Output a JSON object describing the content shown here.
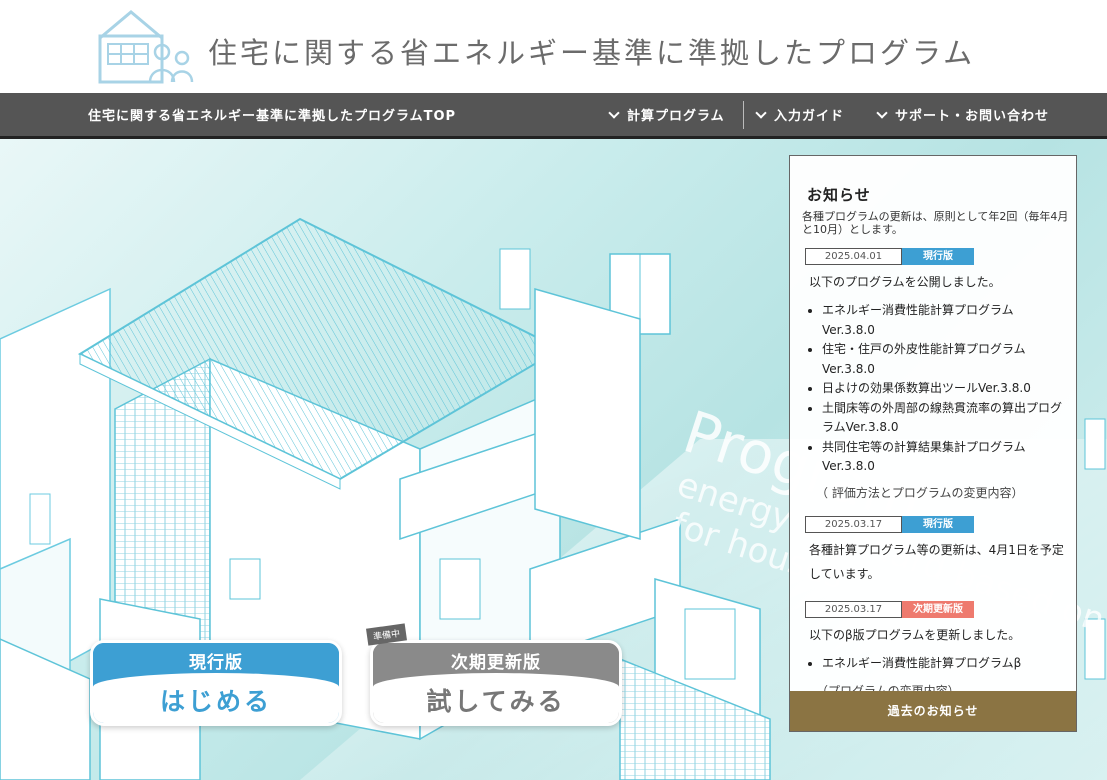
{
  "header": {
    "title": "住宅に関する省エネルギー基準に準拠したプログラム"
  },
  "nav": {
    "top": "住宅に関する省エネルギー基準に準拠したプログラムTOP",
    "items": [
      {
        "label": "計算プログラム"
      },
      {
        "label": "入力ガイド"
      },
      {
        "label": "サポート・お問い合わせ"
      }
    ]
  },
  "hero": {
    "bg_text_1": "Program",
    "bg_text_2": "energy standard based on",
    "bg_text_3": "for houses"
  },
  "buttons": {
    "current": {
      "top": "現行版",
      "bottom": "はじめる"
    },
    "next": {
      "top": "次期更新版",
      "bottom": "試してみる"
    },
    "prep_badge": "準備中"
  },
  "news": {
    "title": "お知らせ",
    "policy": "各種プログラムの更新は、原則として年2回（毎年4月と10月）とします。",
    "entries": [
      {
        "date": "2025.04.01",
        "badge": "現行版",
        "text": "以下のプログラムを公開しました。",
        "items": [
          "エネルギー消費性能計算プログラム Ver.3.8.0",
          "住宅・住戸の外皮性能計算プログラム Ver.3.8.0",
          "日よけの効果係数算出ツールVer.3.8.0",
          "土間床等の外周部の線熱貫流率の算出プログラムVer.3.8.0",
          "共同住宅等の計算結果集計プログラム Ver.3.8.0"
        ],
        "link": "（ 評価方法とプログラムの変更内容）"
      },
      {
        "date": "2025.03.17",
        "badge": "現行版",
        "text": "各種計算プログラム等の更新は、4月1日を予定しています。"
      },
      {
        "date": "2025.03.17",
        "badge": "次期更新版",
        "text": "以下のβ版プログラムを更新しました。",
        "items": [
          "エネルギー消費性能計算プログラムβ"
        ],
        "link": "（プログラムの変更内容）"
      }
    ],
    "footer": "過去のお知らせ"
  },
  "colors": {
    "nav_bg": "#555555",
    "current_blue": "#3d9fd3",
    "next_gray": "#8a8a8a",
    "footer_brown": "#8b7443",
    "badge_red": "#ee7a6e"
  }
}
